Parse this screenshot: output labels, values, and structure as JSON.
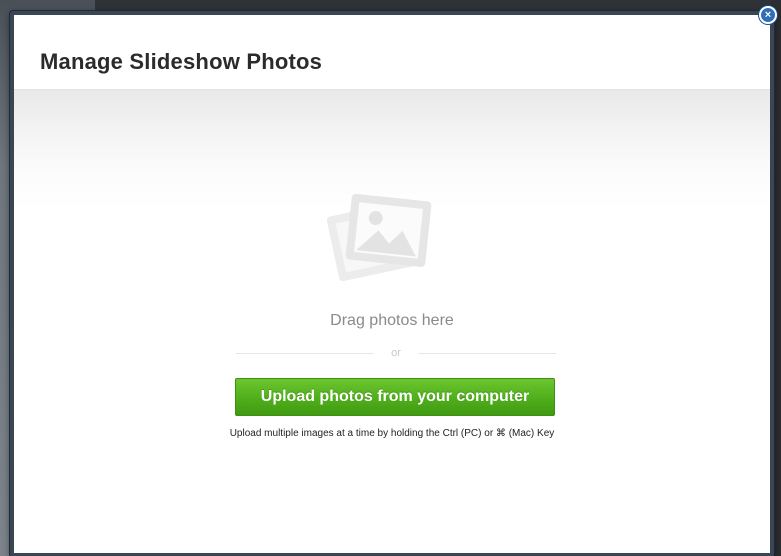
{
  "modal": {
    "title": "Manage Slideshow Photos",
    "close_symbol": "×",
    "close_icon": "close-circle-icon"
  },
  "drop_zone": {
    "icon": "photo-stack-icon",
    "drag_label": "Drag photos here",
    "or_label": "or",
    "upload_button_label": "Upload photos from your computer",
    "hint": "Upload multiple images at a time by holding the Ctrl (PC) or ⌘ (Mac) Key"
  },
  "colors": {
    "upload_button": "#4fae1b",
    "close_button": "#2f6fb8",
    "modal_border": "#3a4654"
  }
}
